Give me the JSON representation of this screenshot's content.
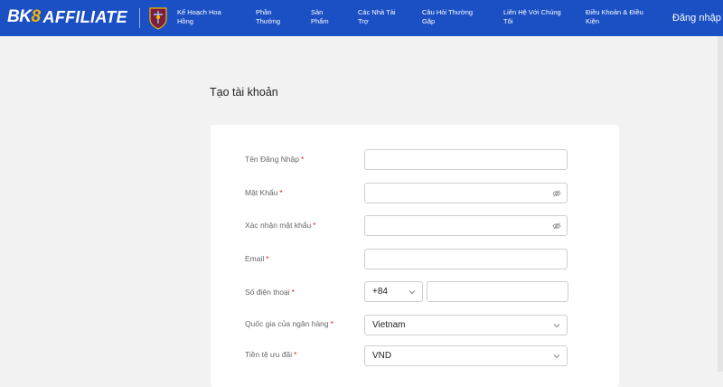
{
  "brand": {
    "part1": "BK",
    "part2": "8",
    "part3": "AFFILIATE"
  },
  "nav": [
    {
      "label": "Kế Hoạch Hoa Hồng"
    },
    {
      "label": "Phần Thưởng"
    },
    {
      "label": "Sản Phẩm"
    },
    {
      "label": "Các Nhà Tài Trợ"
    },
    {
      "label": "Câu Hỏi Thường Gặp"
    },
    {
      "label": "Liên Hệ Với Chúng Tôi"
    },
    {
      "label": "Điều Khoản & Điều Kiện"
    }
  ],
  "login_label": "Đăng nhập",
  "page_title": "Tạo tài khoản",
  "form": {
    "required_mark": "*",
    "username": {
      "label": "Tên Đăng Nhập",
      "value": ""
    },
    "password": {
      "label": "Mật Khẩu",
      "value": ""
    },
    "confirm_password": {
      "label": "Xác nhận mật khẩu",
      "value": ""
    },
    "email": {
      "label": "Email",
      "value": ""
    },
    "phone": {
      "label": "Số điện thoại",
      "country_code": "+84",
      "value": ""
    },
    "bank_country": {
      "label": "Quốc gia của ngân hàng",
      "value": "Vietnam"
    },
    "currency": {
      "label": "Tiền tệ ưu đãi",
      "value": "VND"
    }
  },
  "colors": {
    "header": "#1b4fc4",
    "accent_gold": "#f4b400",
    "required": "#e02020"
  },
  "icons": [
    "club-crest-icon",
    "eye-off-icon",
    "chevron-down-icon"
  ]
}
